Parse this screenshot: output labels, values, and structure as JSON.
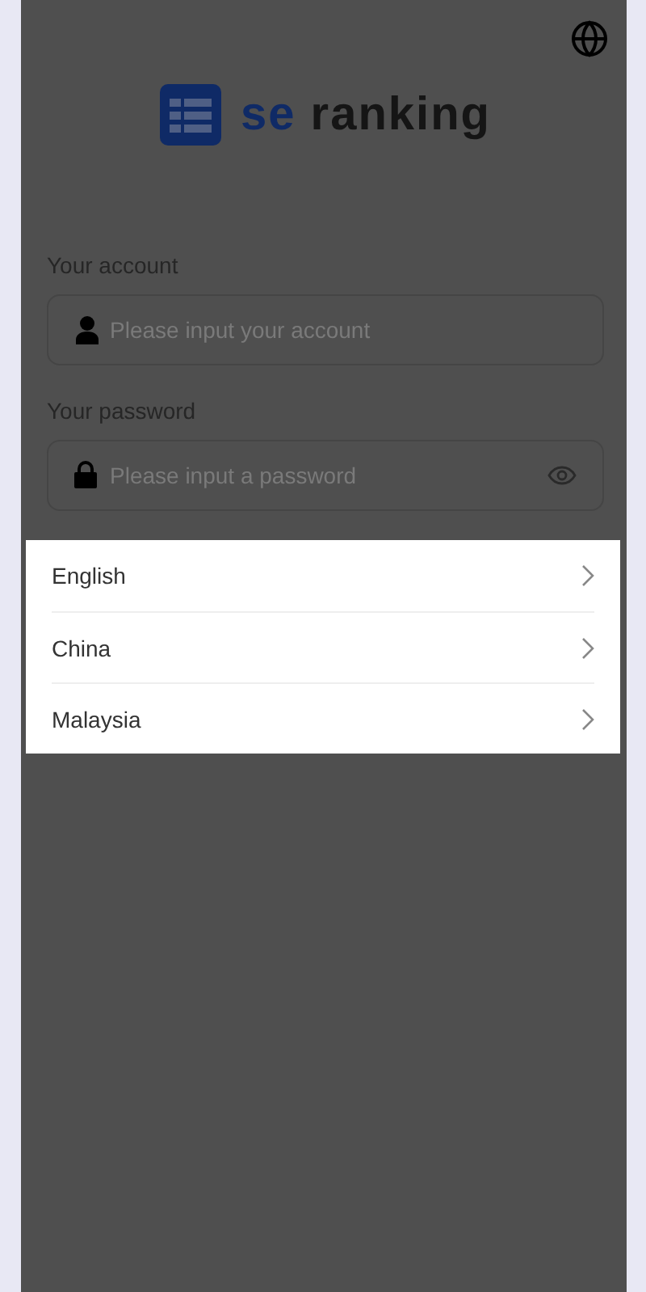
{
  "logo": {
    "accent": "se",
    "name": "ranking"
  },
  "account": {
    "label": "Your account",
    "placeholder": "Please input your account"
  },
  "password": {
    "label": "Your password",
    "placeholder": "Please input a password"
  },
  "language_menu": {
    "open": true,
    "items": [
      {
        "label": "English"
      },
      {
        "label": "China"
      },
      {
        "label": "Malaysia"
      }
    ]
  }
}
